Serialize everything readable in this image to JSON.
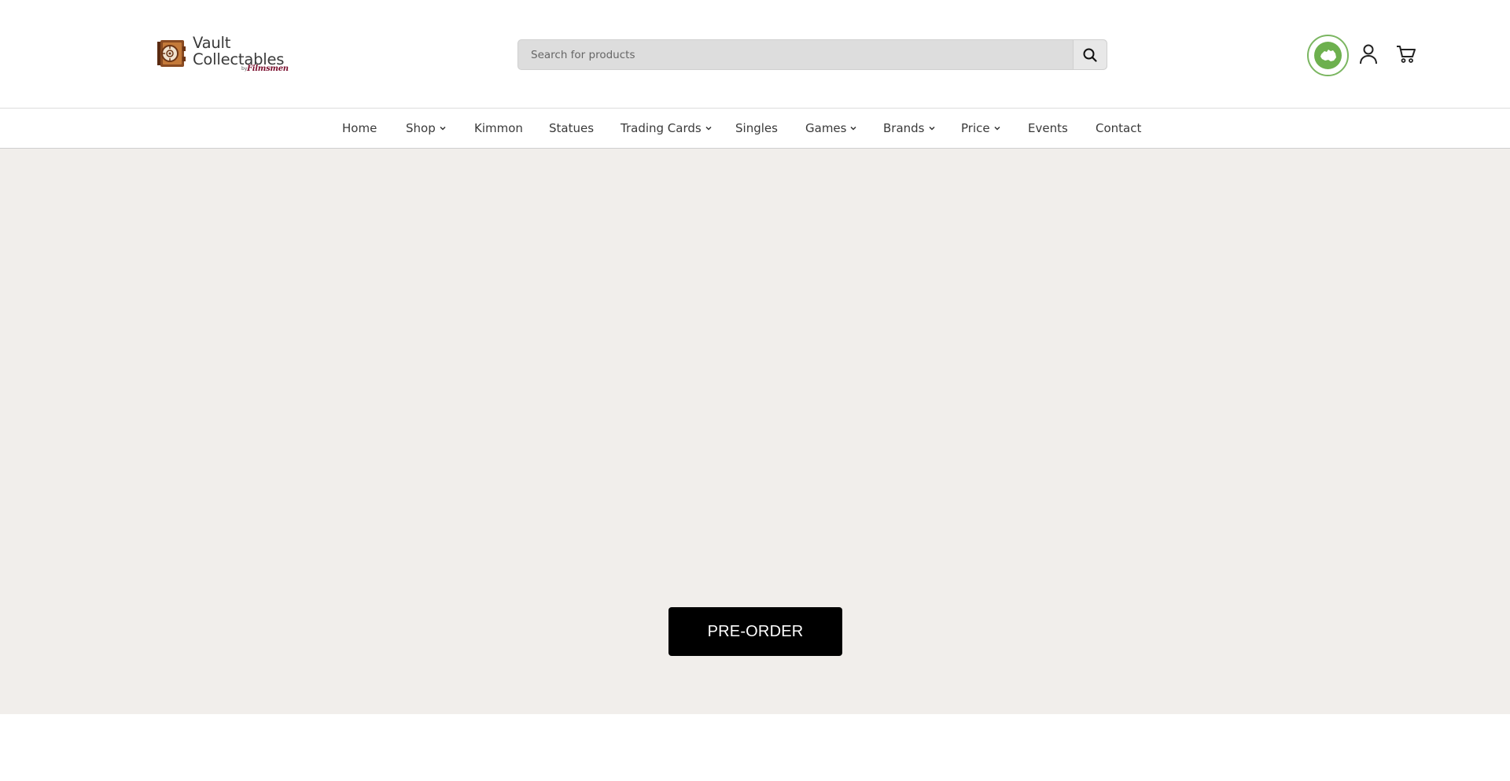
{
  "logo": {
    "line1": "Vault",
    "line2": "Collectables",
    "by": "by",
    "brand": "Filmsmen"
  },
  "search": {
    "placeholder": "Search for products"
  },
  "header_icons": [
    "australian-owned-badge-icon",
    "account-icon",
    "cart-icon"
  ],
  "nav": {
    "items": [
      {
        "label": "Home",
        "dropdown": false
      },
      {
        "label": "Shop",
        "dropdown": true
      },
      {
        "label": "Kimmon",
        "dropdown": false
      },
      {
        "label": "Statues",
        "dropdown": false
      },
      {
        "label": "Trading Cards",
        "dropdown": true
      },
      {
        "label": "Singles",
        "dropdown": false
      },
      {
        "label": "Games",
        "dropdown": true
      },
      {
        "label": "Brands",
        "dropdown": true
      },
      {
        "label": "Price",
        "dropdown": true
      },
      {
        "label": "Events",
        "dropdown": false
      },
      {
        "label": "Contact",
        "dropdown": false
      }
    ]
  },
  "hero": {
    "cta_label": "PRE-ORDER"
  },
  "colors": {
    "hero_bg": "#f1eeeb",
    "cta_bg": "#000000",
    "badge_green": "#6db04e",
    "brand_maroon": "#7a0f2e"
  }
}
